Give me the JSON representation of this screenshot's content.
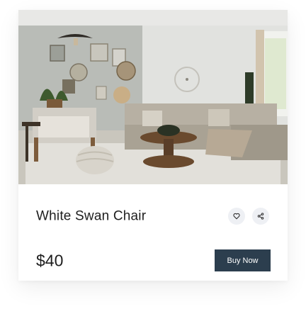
{
  "product": {
    "title": "White Swan Chair",
    "price": "$40",
    "buy_label": "Buy Now",
    "image_alt": "Living room with sofa, armchair, coffee table and wall decor"
  },
  "actions": {
    "favorite_icon": "heart-icon",
    "share_icon": "share-icon"
  },
  "colors": {
    "button_bg": "#2c3e4e",
    "icon_bg": "#eef0f4",
    "text": "#1e1e1e"
  }
}
